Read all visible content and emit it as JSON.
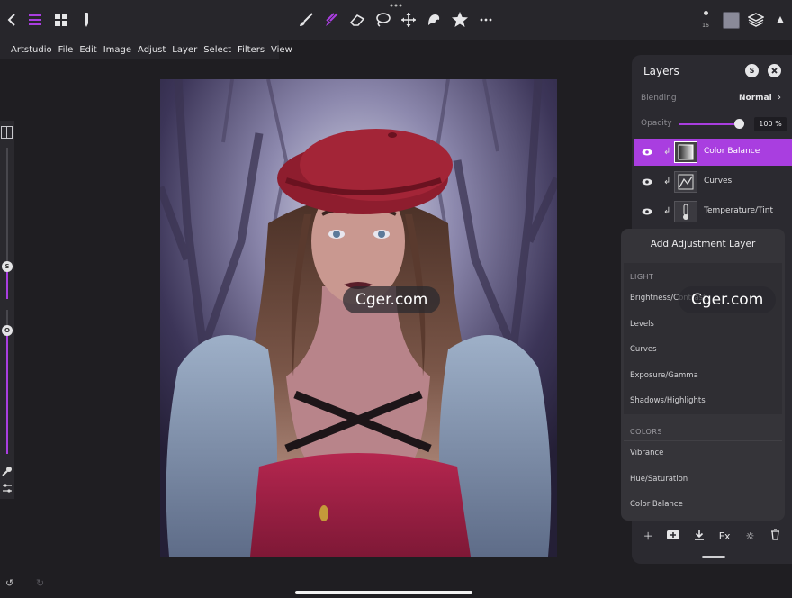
{
  "app": {
    "menu": [
      "Artstudio",
      "File",
      "Edit",
      "Image",
      "Adjust",
      "Layer",
      "Select",
      "Filters",
      "View"
    ],
    "brush_count": "16",
    "accent_color": "#a93ee0"
  },
  "left_rail": {
    "size_knob": "S",
    "opacity_knob": "O"
  },
  "watermarks": [
    "Cger.com",
    "Cger.com"
  ],
  "layers_panel": {
    "title": "Layers",
    "s_button": "S",
    "blending_label": "Blending",
    "blending_value": "Normal",
    "opacity_label": "Opacity",
    "opacity_value": "100 %",
    "layers": [
      {
        "name": "Color Balance",
        "selected": true
      },
      {
        "name": "Curves",
        "selected": false
      },
      {
        "name": "Temperature/Tint",
        "selected": false
      }
    ],
    "footer_fx": "Fx"
  },
  "adjustment_popup": {
    "title": "Add Adjustment Layer",
    "sections": [
      {
        "label": "LIGHT",
        "items": [
          "Brightness/Contrast",
          "Levels",
          "Curves",
          "Exposure/Gamma",
          "Shadows/Highlights"
        ]
      },
      {
        "label": "COLORS",
        "items": [
          "Vibrance",
          "Hue/Saturation",
          "Color Balance"
        ]
      }
    ]
  }
}
